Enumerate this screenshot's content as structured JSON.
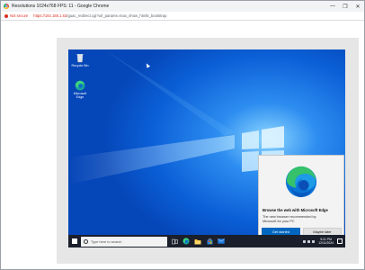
{
  "window": {
    "title": "Resolutions 1024x768 FPS: 11 - Google Chrome",
    "controls": [
      "—",
      "❐",
      "✕"
    ]
  },
  "address": {
    "security": "Not secure",
    "url_host": "https://192.168.1.63",
    "url_path": "/guac_redirect.cgi?url_params=max_show_html5_bootstrap"
  },
  "desktop": {
    "icons": [
      {
        "label": "Recycle Bin",
        "icon": "recycle-bin-icon"
      },
      {
        "label": "Microsoft Edge",
        "icon": "edge-icon"
      }
    ]
  },
  "toast": {
    "heading": "Browse the web with Microsoft Edge",
    "body": "The new browser recommended by Microsoft for your PC",
    "primary_button": "Get started",
    "secondary_button": "Maybe later"
  },
  "taskbar": {
    "search_placeholder": "Type here to search",
    "apps": [
      "task-view-icon",
      "edge-icon",
      "file-explorer-icon",
      "store-icon",
      "mail-icon"
    ],
    "time": "5:21 PM",
    "date": "12/11/2024"
  },
  "colors": {
    "accent": "#0067c0",
    "desktop": "#0a5ad4",
    "taskbar": "#1a1f2b",
    "not_secure": "#d93025"
  }
}
